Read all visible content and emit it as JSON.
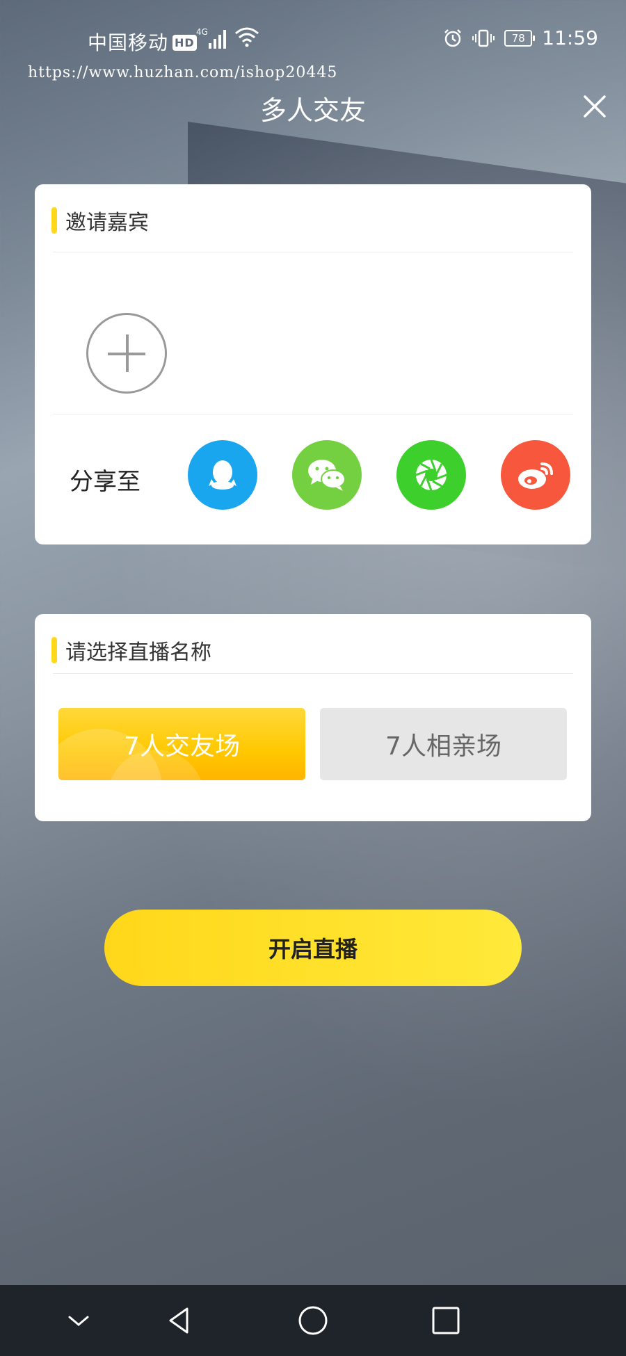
{
  "status_bar": {
    "carrier": "中国移动",
    "hd": "HD",
    "network": "4G",
    "battery": "78",
    "time": "11:59"
  },
  "watermark": "https://www.huzhan.com/ishop20445",
  "header": {
    "title": "多人交友"
  },
  "invite": {
    "title": "邀请嘉宾",
    "share_label": "分享至",
    "share_targets": [
      {
        "name": "qq-icon",
        "color": "#1aa6ee"
      },
      {
        "name": "wechat-icon",
        "color": "#74d040"
      },
      {
        "name": "moments-icon",
        "color": "#3dcf2c"
      },
      {
        "name": "weibo-icon",
        "color": "#f7573c"
      }
    ]
  },
  "room_name": {
    "title": "请选择直播名称",
    "options": [
      {
        "label": "7人交友场",
        "selected": true
      },
      {
        "label": "7人相亲场",
        "selected": false
      }
    ]
  },
  "start_button": "开启直播",
  "colors": {
    "accent": "#ffd81c"
  }
}
